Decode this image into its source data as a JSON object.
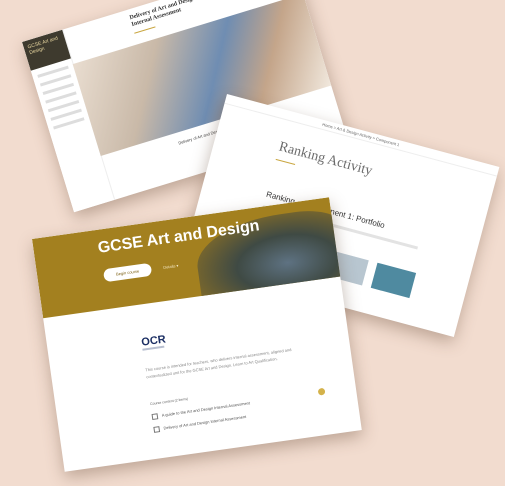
{
  "back_card": {
    "title": "Delivery of Art and Design Internal Assessment",
    "sidebar_header": "GCSE Art and Design",
    "caption": "Delivery of Art and Design Internal Assessment"
  },
  "middle_card": {
    "breadcrumb": "Home > Art & Design Activity > Component 1",
    "heading": "Ranking Activity",
    "subheading": "Ranking ... Component 1: Portfolio"
  },
  "front_card": {
    "course_title": "GCSE Art and Design",
    "start_button": "Begin course",
    "more_link": "Details ▾",
    "logo": "OCR",
    "intro": "This course is intended for teachers, who delivers internal assessment, aligned and contextualized unit for the GCSE Art and Design. Learn to Art Qualification.",
    "section_label": "Course content (2 items)",
    "items": [
      "A guide to the Art and Design Internal Assessment",
      "Delivery of Art and Design Internal Assessment"
    ]
  }
}
